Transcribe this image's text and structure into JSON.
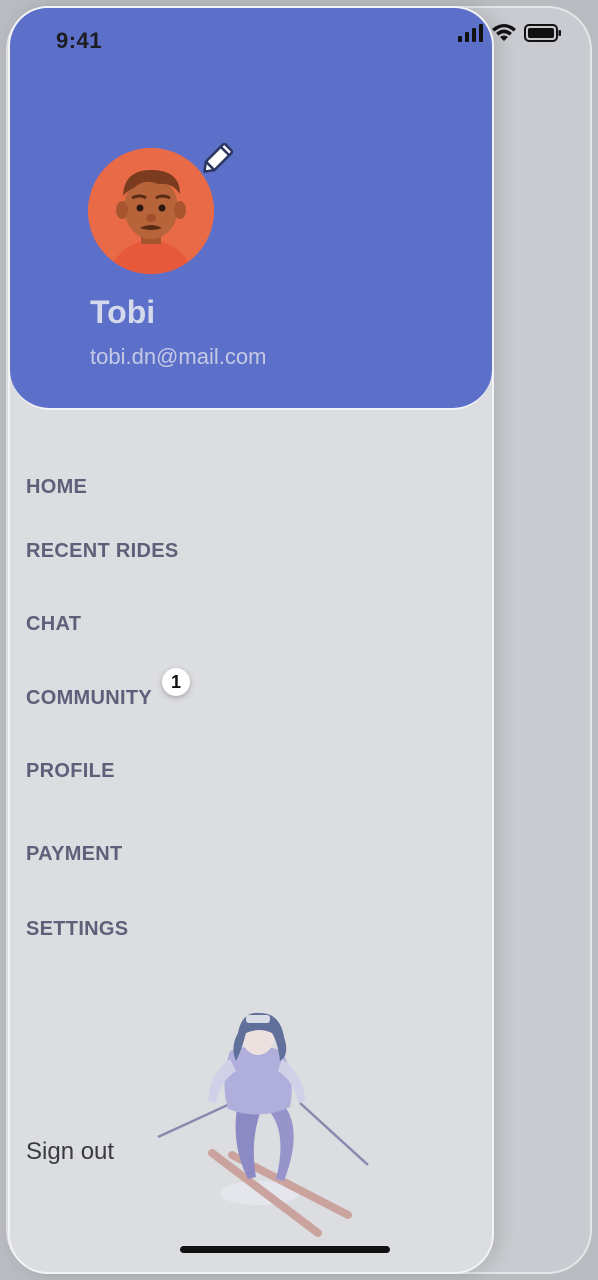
{
  "status_bar": {
    "time": "9:41"
  },
  "profile": {
    "name": "Tobi",
    "email": "tobi.dn@mail.com",
    "avatar_icon": "avatar-illustration",
    "edit_icon": "pencil-icon"
  },
  "menu": {
    "items": [
      {
        "label": "HOME"
      },
      {
        "label": "RECENT RIDES"
      },
      {
        "label": "CHAT"
      },
      {
        "label": "COMMUNITY",
        "badge": "1"
      },
      {
        "label": "PROFILE"
      },
      {
        "label": "PAYMENT"
      },
      {
        "label": "SETTINGS"
      }
    ]
  },
  "footer": {
    "sign_out": "Sign out",
    "illustration": "skier-illustration"
  },
  "colors": {
    "header": "#5c6fc9",
    "drawer": "#dcdde0",
    "menu_text": "#5f5f7a",
    "avatar_bg": "#e96a47"
  }
}
